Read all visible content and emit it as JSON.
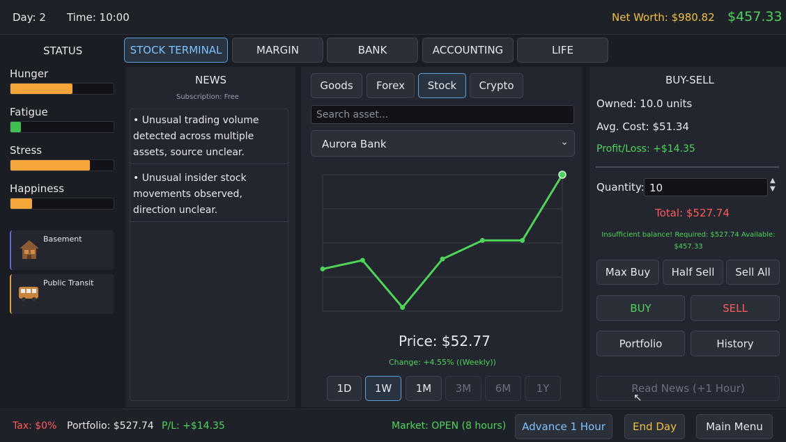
{
  "header": {
    "day": "Day: 2",
    "time": "Time: 10:00",
    "net_worth": "Net Worth: $980.82",
    "cash": "$457.33"
  },
  "status": {
    "title": "STATUS",
    "bars": [
      {
        "label": "Hunger",
        "value": 0.6,
        "color": "#f5a63a"
      },
      {
        "label": "Fatigue",
        "value": 0.1,
        "color": "#3fbf4f"
      },
      {
        "label": "Stress",
        "value": 0.77,
        "color": "#f5a63a"
      },
      {
        "label": "Happiness",
        "value": 0.21,
        "color": "#f5a63a"
      }
    ],
    "cards": [
      {
        "label": "Basement",
        "icon": "house-icon",
        "accent": "#5b6cd6"
      },
      {
        "label": "Public Transit",
        "icon": "bus-icon",
        "accent": "#e0a040"
      }
    ]
  },
  "tabs": [
    "STOCK TERMINAL",
    "MARGIN",
    "BANK",
    "ACCOUNTING",
    "LIFE"
  ],
  "news": {
    "title": "NEWS",
    "subscription": "Subscription: Free",
    "items": [
      "• Unusual trading volume detected across multiple assets, source unclear.",
      "• Unusual insider stock movements observed, direction unclear."
    ]
  },
  "market": {
    "categories": [
      "Goods",
      "Forex",
      "Stock",
      "Crypto"
    ],
    "selected_category": "Stock",
    "search_placeholder": "Search asset...",
    "selected_asset": "Aurora Bank",
    "price": "Price: $52.77",
    "change": "Change: +4.55% ((Weekly))",
    "ranges": [
      "1D",
      "1W",
      "1M",
      "3M",
      "6M",
      "1Y"
    ],
    "selected_range": "1W"
  },
  "chart_data": {
    "type": "line",
    "x": [
      1,
      2,
      3,
      4,
      5,
      6,
      7
    ],
    "values": [
      50.9,
      51.6,
      47.8,
      51.7,
      53.2,
      53.2,
      58.5
    ],
    "ylim": [
      47.5,
      58.5
    ],
    "grid": true,
    "color": "#4fd45a"
  },
  "trade": {
    "title": "BUY-SELL",
    "owned": "Owned: 10.0 units",
    "avg_cost": "Avg. Cost: $51.34",
    "pnl": "Profit/Loss: +$14.35",
    "quantity_label": "Quantity:",
    "quantity_value": "10",
    "total": "Total: $527.74",
    "warning": "Insufficient balance! Required: $527.74 Available: $457.33",
    "max_buy": "Max Buy",
    "half_sell": "Half Sell",
    "sell_all": "Sell All",
    "buy": "BUY",
    "sell": "SELL",
    "portfolio": "Portfolio",
    "history": "History",
    "read_news": "Read News (+1 Hour)"
  },
  "footer": {
    "tax": "Tax: $0%",
    "portfolio": "Portfolio: $527.74",
    "pl": "P/L: +$14.35",
    "market_status": "Market: OPEN (8 hours)",
    "advance": "Advance 1 Hour",
    "end_day": "End Day",
    "main_menu": "Main Menu"
  }
}
